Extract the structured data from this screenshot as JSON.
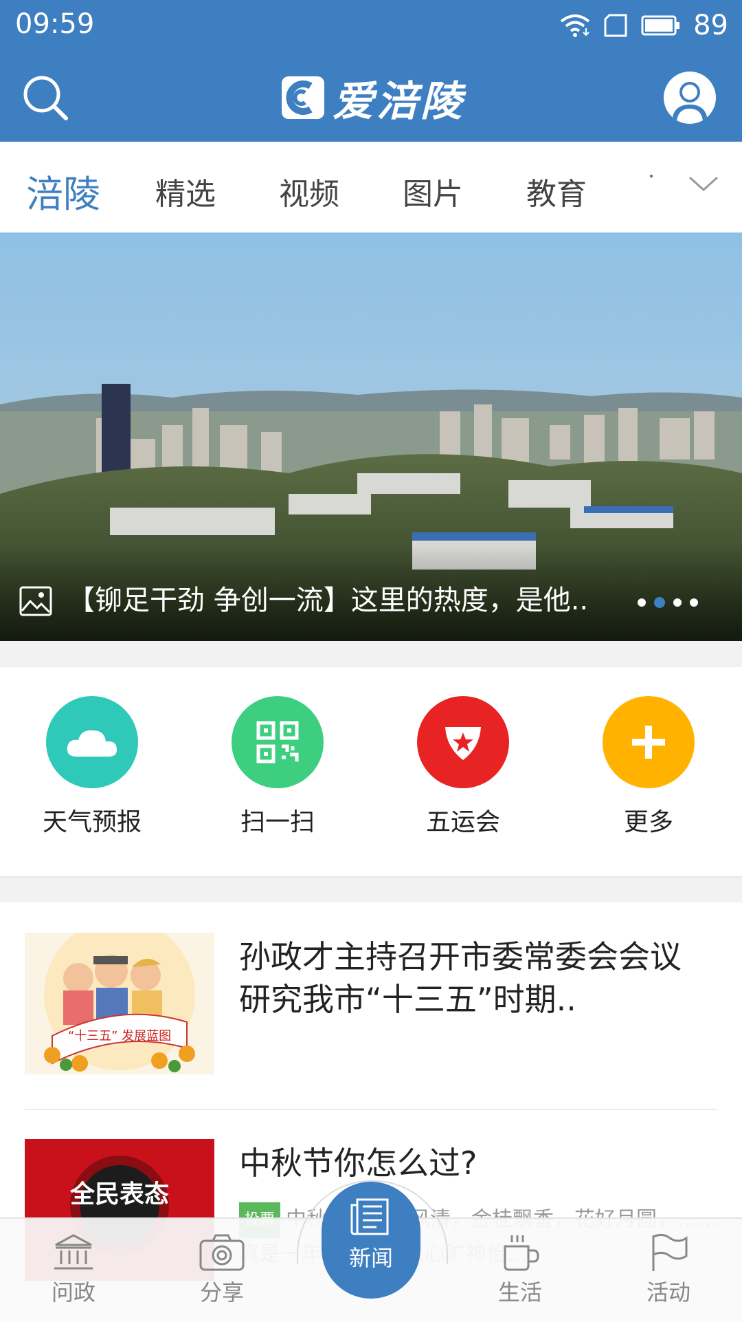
{
  "status_bar": {
    "time": "09:59",
    "battery": "89"
  },
  "header": {
    "app_name": "爱涪陵"
  },
  "tabs": [
    {
      "label": "涪陵",
      "active": true
    },
    {
      "label": "精选",
      "active": false
    },
    {
      "label": "视频",
      "active": false
    },
    {
      "label": "图片",
      "active": false
    },
    {
      "label": "教育",
      "active": false
    }
  ],
  "banner": {
    "caption": "【铆足干劲 争创一流】这里的热度，是他..",
    "dots": 4,
    "active_dot": 2
  },
  "shortcuts": [
    {
      "label": "天气预报",
      "icon": "cloud-icon",
      "color": "#2ec9b8"
    },
    {
      "label": "扫一扫",
      "icon": "qrcode-icon",
      "color": "#3dcf7f"
    },
    {
      "label": "五运会",
      "icon": "star-shield-icon",
      "color": "#e82323"
    },
    {
      "label": "更多",
      "icon": "plus-icon",
      "color": "#ffb300"
    }
  ],
  "news": [
    {
      "title": "孙政才主持召开市委常委会会议 研究我市“十三五”时期..",
      "thumb_text": "“十三五” 发展蓝图"
    },
    {
      "title": "中秋节你怎么过?",
      "tag": "投票",
      "summary": "中秋……月明风清，金桂飘香，花好月圆，……真是一年中最为令人心旷神怡…",
      "thumb_text": "全民表态"
    }
  ],
  "bottom_nav": [
    {
      "label": "问政",
      "icon": "government-icon"
    },
    {
      "label": "分享",
      "icon": "camera-icon"
    },
    {
      "label": "新闻",
      "icon": "newspaper-icon",
      "active": true
    },
    {
      "label": "生活",
      "icon": "cup-icon"
    },
    {
      "label": "活动",
      "icon": "flag-icon"
    }
  ]
}
